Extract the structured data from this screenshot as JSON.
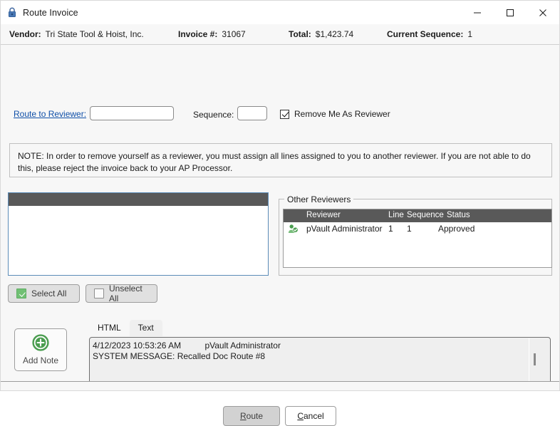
{
  "window": {
    "title": "Route Invoice",
    "icon": "lock-icon",
    "controls": {
      "minimize": "minimize-icon",
      "maximize": "maximize-icon",
      "close": "close-icon"
    }
  },
  "info_bar": {
    "vendor_label": "Vendor:",
    "vendor_value": "Tri State Tool & Hoist, Inc.",
    "invoice_label": "Invoice #:",
    "invoice_value": "31067",
    "total_label": "Total:",
    "total_value": "$1,423.74",
    "sequence_label": "Current Sequence:",
    "sequence_value": "1"
  },
  "route_row": {
    "link_label": "Route to Reviewer:",
    "reviewer_value": "",
    "reviewer_placeholder": "",
    "sequence_label": "Sequence:",
    "sequence_value": "",
    "sequence_placeholder": "",
    "remove_checkbox_label": "Remove Me As Reviewer",
    "remove_checkbox_checked": true
  },
  "note_banner": {
    "text": "NOTE: In order to remove yourself as a reviewer, you must assign all lines assigned to you to another reviewer. If you are not able to do this, please reject the invoice back to your AP Processor."
  },
  "lines_grid": {
    "rows": []
  },
  "other_reviewers": {
    "group_title": "Other Reviewers",
    "columns": [
      "Reviewer",
      "Line",
      "Sequence",
      "Status"
    ],
    "rows": [
      {
        "icon": "reviewer-approved-icon",
        "reviewer": "pVault Administrator",
        "line": "1",
        "sequence": "1",
        "status": "Approved"
      }
    ]
  },
  "selection_buttons": {
    "select_all": "Select All",
    "select_all_checked": true,
    "unselect_all": "Unselect All",
    "unselect_all_checked": false
  },
  "notes_panel": {
    "add_note_label": "Add Note",
    "add_note_icon": "plus-circle-icon",
    "tabs": [
      {
        "label": "HTML",
        "active": false
      },
      {
        "label": "Text",
        "active": true
      }
    ],
    "note_line_1": "4/12/2023 10:53:26 AM          pVault Administrator",
    "note_line_2": "SYSTEM MESSAGE: Recalled Doc Route #8"
  },
  "footer": {
    "route_button_prefix": "",
    "route_button_accel": "R",
    "route_button_suffix": "oute",
    "route_button_enabled": false,
    "cancel_button_prefix": "",
    "cancel_button_accel": "C",
    "cancel_button_suffix": "ancel"
  },
  "colors": {
    "link": "#0f4fa8",
    "grid_header": "#595959",
    "focus_border": "#5b8cb8",
    "accent_green": "#4a9d4f",
    "dialog_bg": "#f7f7f7"
  }
}
